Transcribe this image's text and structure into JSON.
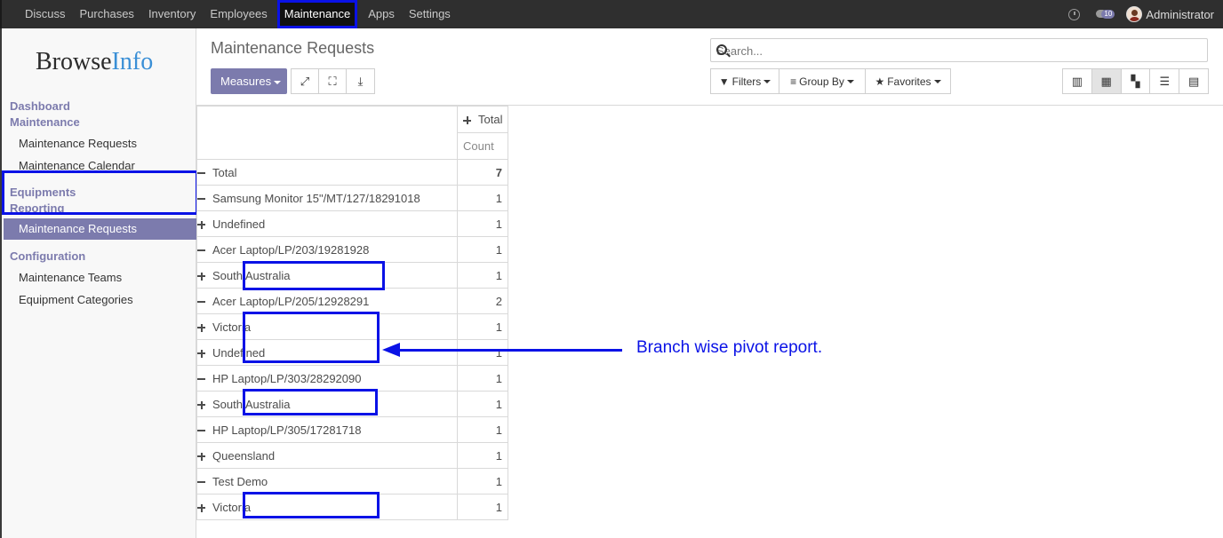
{
  "topbar": {
    "menu": [
      "Discuss",
      "Purchases",
      "Inventory",
      "Employees",
      "Maintenance",
      "Apps",
      "Settings"
    ],
    "active": "Maintenance",
    "badge": "10",
    "user": "Administrator"
  },
  "sidebar": {
    "logo_main": "Browse",
    "logo_accent": "Info",
    "sections": {
      "dashboard": "Dashboard",
      "maintenance": "Maintenance",
      "equipments": "Equipments",
      "reporting": "Reporting",
      "configuration": "Configuration"
    },
    "items": {
      "requests": "Maintenance Requests",
      "calendar": "Maintenance Calendar",
      "report_requests": "Maintenance Requests",
      "teams": "Maintenance Teams",
      "categories": "Equipment Categories"
    }
  },
  "control": {
    "title": "Maintenance Requests",
    "search_placeholder": "Search...",
    "measures": "Measures",
    "filters": "Filters",
    "group_by": "Group By",
    "favorites": "Favorites"
  },
  "pivot": {
    "col_total": "Total",
    "col_measure": "Count",
    "rows": [
      {
        "label": "Total",
        "value": "7",
        "level": 0,
        "toggle": "minus"
      },
      {
        "label": "Samsung Monitor 15\"/MT/127/18291018",
        "value": "1",
        "level": 1,
        "toggle": "minus"
      },
      {
        "label": "Undefined",
        "value": "1",
        "level": 2,
        "toggle": "plus"
      },
      {
        "label": "Acer Laptop/LP/203/19281928",
        "value": "1",
        "level": 1,
        "toggle": "minus"
      },
      {
        "label": "South Australia",
        "value": "1",
        "level": 2,
        "toggle": "plus"
      },
      {
        "label": "Acer Laptop/LP/205/12928291",
        "value": "2",
        "level": 1,
        "toggle": "minus"
      },
      {
        "label": "Victoria",
        "value": "1",
        "level": 2,
        "toggle": "plus"
      },
      {
        "label": "Undefined",
        "value": "1",
        "level": 2,
        "toggle": "plus"
      },
      {
        "label": "HP Laptop/LP/303/28292090",
        "value": "1",
        "level": 1,
        "toggle": "minus"
      },
      {
        "label": "South Australia",
        "value": "1",
        "level": 2,
        "toggle": "plus"
      },
      {
        "label": "HP Laptop/LP/305/17281718",
        "value": "1",
        "level": 1,
        "toggle": "minus"
      },
      {
        "label": "Queensland",
        "value": "1",
        "level": 2,
        "toggle": "plus"
      },
      {
        "label": "Test Demo",
        "value": "1",
        "level": 1,
        "toggle": "minus"
      },
      {
        "label": "Victoria",
        "value": "1",
        "level": 2,
        "toggle": "plus"
      }
    ]
  },
  "annotation": "Branch wise pivot report.",
  "colors": {
    "accent": "#7c7bad",
    "highlight": "#0a12e6",
    "navbar": "#2f2f2f"
  }
}
